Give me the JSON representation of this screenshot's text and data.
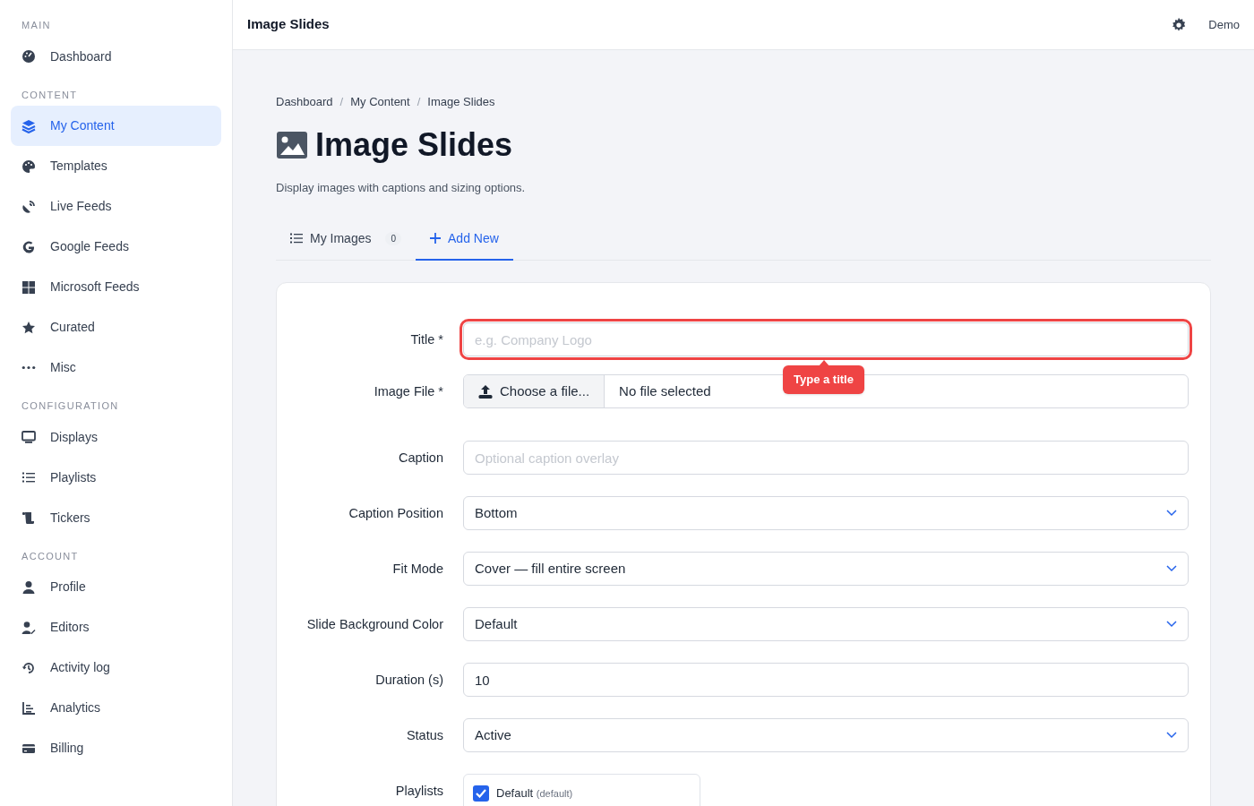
{
  "sidebar": {
    "sections": [
      {
        "heading": "MAIN",
        "items": [
          {
            "label": "Dashboard",
            "selected": false
          }
        ]
      },
      {
        "heading": "CONTENT",
        "items": [
          {
            "label": "My Content",
            "selected": true
          },
          {
            "label": "Templates",
            "selected": false
          },
          {
            "label": "Live Feeds",
            "selected": false
          },
          {
            "label": "Google Feeds",
            "selected": false
          },
          {
            "label": "Microsoft Feeds",
            "selected": false
          },
          {
            "label": "Curated",
            "selected": false
          },
          {
            "label": "Misc",
            "selected": false
          }
        ]
      },
      {
        "heading": "CONFIGURATION",
        "items": [
          {
            "label": "Displays",
            "selected": false
          },
          {
            "label": "Playlists",
            "selected": false
          },
          {
            "label": "Tickers",
            "selected": false
          }
        ]
      },
      {
        "heading": "ACCOUNT",
        "items": [
          {
            "label": "Profile",
            "selected": false
          },
          {
            "label": "Editors",
            "selected": false
          },
          {
            "label": "Activity log",
            "selected": false
          },
          {
            "label": "Analytics",
            "selected": false
          },
          {
            "label": "Billing",
            "selected": false
          }
        ]
      }
    ]
  },
  "header": {
    "title": "Image Slides",
    "user": "Demo"
  },
  "breadcrumbs": {
    "separator": "/",
    "items": [
      "Dashboard",
      "My Content",
      "Image Slides"
    ]
  },
  "page": {
    "title": "Image Slides",
    "subtitle": "Display images with captions and sizing options."
  },
  "tabs": [
    {
      "label": "My Images",
      "count": "0",
      "selected": false
    },
    {
      "label": "Add New",
      "selected": true
    }
  ],
  "form": {
    "fields": [
      {
        "kind": "text",
        "label": "Title *",
        "placeholder": "e.g. Company Logo",
        "invalid": true,
        "error": "Type a title"
      },
      {
        "kind": "file",
        "label": "Image File *",
        "button": "Choose a file...",
        "value": "No file selected"
      },
      {
        "kind": "text",
        "label": "Caption",
        "placeholder": "Optional caption overlay",
        "invalid": false
      },
      {
        "kind": "select",
        "label": "Caption Position",
        "value": "Bottom"
      },
      {
        "kind": "select",
        "label": "Fit Mode",
        "value": "Cover — fill entire screen"
      },
      {
        "kind": "select",
        "label": "Slide Background Color",
        "value": "Default"
      },
      {
        "kind": "text",
        "label": "Duration (s)",
        "value": "10",
        "invalid": false
      },
      {
        "kind": "select",
        "label": "Status",
        "value": "Active"
      },
      {
        "kind": "checklist",
        "label": "Playlists",
        "options": [
          {
            "label": "Default",
            "note": "(default)",
            "checked": true
          }
        ]
      }
    ]
  }
}
